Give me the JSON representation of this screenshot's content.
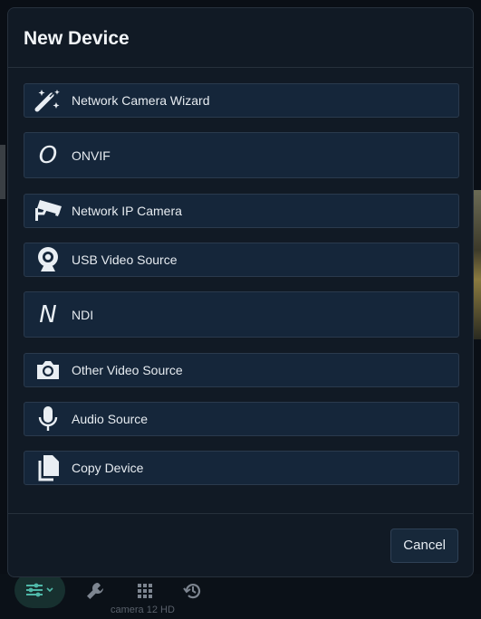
{
  "dialog": {
    "title": "New Device",
    "options": [
      {
        "label": "Network Camera Wizard",
        "icon": "magic-wand-icon"
      },
      {
        "label": "ONVIF",
        "icon": "onvif-letter-icon",
        "glyph": "O"
      },
      {
        "label": "Network IP Camera",
        "icon": "cctv-camera-icon"
      },
      {
        "label": "USB Video Source",
        "icon": "webcam-icon"
      },
      {
        "label": "NDI",
        "icon": "ndi-letter-icon",
        "glyph": "N"
      },
      {
        "label": "Other Video Source",
        "icon": "camera-icon"
      },
      {
        "label": "Audio Source",
        "icon": "microphone-icon"
      },
      {
        "label": "Copy Device",
        "icon": "copy-icon"
      }
    ],
    "cancel_label": "Cancel"
  },
  "background": {
    "toolbar": [
      "sliders-icon",
      "wrench-icon",
      "grid-icon",
      "history-icon"
    ],
    "caption": "camera 12 HD"
  },
  "colors": {
    "dialog_bg": "#111a25",
    "option_bg": "#15263a",
    "accent_teal": "#4fb8a8"
  }
}
